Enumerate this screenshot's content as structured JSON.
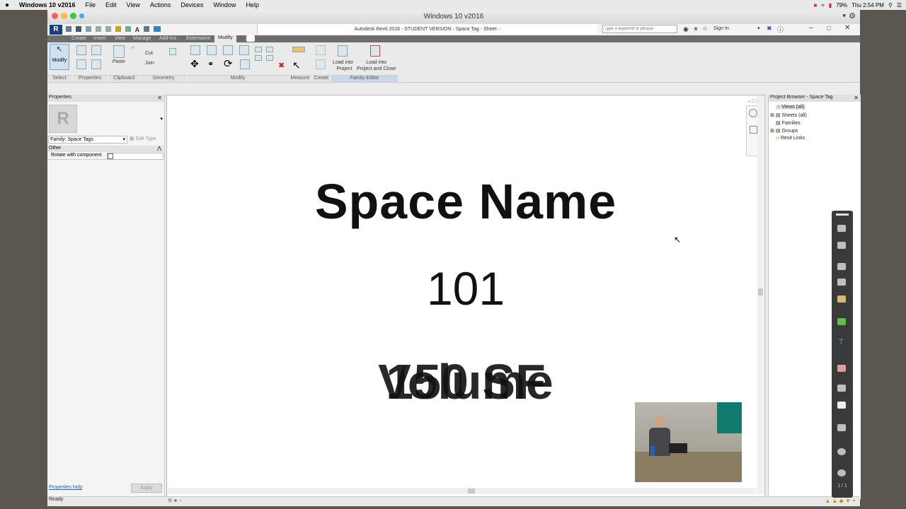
{
  "macmenu": {
    "apple": "",
    "app": "Windows 10 v2016",
    "items": [
      "File",
      "Edit",
      "View",
      "Actions",
      "Devices",
      "Window",
      "Help"
    ],
    "battery": "79%",
    "clock": "Thu 2:54 PM"
  },
  "vm": {
    "title": "Windows 10 v2016"
  },
  "revit": {
    "title": "Autodesk Revit 2016 - STUDENT VERSION -    Space Tag - Sheet: -",
    "search_placeholder": "Type a keyword or phrase",
    "sign_in": "Sign In",
    "tabs": [
      "Create",
      "Insert",
      "View",
      "Manage",
      "Add-Ins",
      "Extensions",
      "Modify"
    ],
    "active_tab": "Modify",
    "ribbon": {
      "modify_btn": "Modify",
      "select_label": "Select",
      "properties_label": "Properties",
      "paste_label": "Paste",
      "cut": "Cut",
      "join": "Join",
      "clipboard_label": "Clipboard",
      "geometry_label": "Geometry",
      "modify_label": "Modify",
      "measure_label": "Measure",
      "create_label": "Create",
      "load_into_project": [
        "Load into",
        "Project"
      ],
      "load_into_project_close": [
        "Load into",
        "Project and Close"
      ],
      "family_editor_label": "Family Editor"
    }
  },
  "properties": {
    "title": "Properties",
    "family": "Family: Space Tags",
    "edit_type": "Edit Type",
    "group": "Other",
    "param": "Rotate with component",
    "help": "Properties help",
    "apply": "Apply"
  },
  "canvas": {
    "line1": "Space Name",
    "line2": "101",
    "line3a": "Volume",
    "line3b": "150 SF"
  },
  "browser": {
    "title": "Project Browser - Space Tag",
    "items": [
      "Views (all)",
      "Sheets (all)",
      "Families",
      "Groups",
      "Revit Links"
    ]
  },
  "status": {
    "text": "Ready"
  },
  "toolbar": {
    "page": "1 / 1"
  }
}
